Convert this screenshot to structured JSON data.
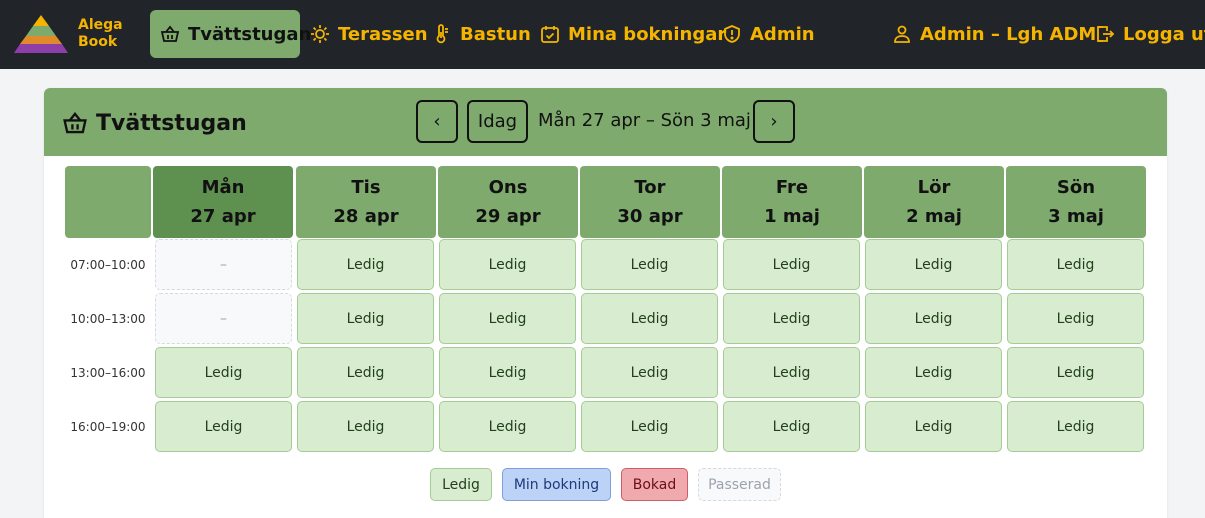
{
  "brand": {
    "line1": "Alega",
    "line2": "Book"
  },
  "nav": {
    "laundry": "Tvättstugan",
    "terrace": "Terassen",
    "sauna": "Bastun",
    "my_bookings": "Mina bokningar",
    "admin": "Admin",
    "user": "Admin – Lgh ADM",
    "logout": "Logga ut"
  },
  "card": {
    "title": "Tvättstugan",
    "today_label": "Idag",
    "prev_glyph": "‹",
    "next_glyph": "›",
    "week_range": "Mån 27 apr – Sön 3 maj"
  },
  "days": [
    {
      "name": "Mån",
      "date": "27 apr"
    },
    {
      "name": "Tis",
      "date": "28 apr"
    },
    {
      "name": "Ons",
      "date": "29 apr"
    },
    {
      "name": "Tor",
      "date": "30 apr"
    },
    {
      "name": "Fre",
      "date": "1 maj"
    },
    {
      "name": "Lör",
      "date": "2 maj"
    },
    {
      "name": "Sön",
      "date": "3 maj"
    }
  ],
  "times": [
    "07:00–10:00",
    "10:00–13:00",
    "13:00–16:00",
    "16:00–19:00"
  ],
  "slots": [
    [
      "–",
      "Ledig",
      "Ledig",
      "Ledig",
      "Ledig",
      "Ledig",
      "Ledig"
    ],
    [
      "–",
      "Ledig",
      "Ledig",
      "Ledig",
      "Ledig",
      "Ledig",
      "Ledig"
    ],
    [
      "Ledig",
      "Ledig",
      "Ledig",
      "Ledig",
      "Ledig",
      "Ledig",
      "Ledig"
    ],
    [
      "Ledig",
      "Ledig",
      "Ledig",
      "Ledig",
      "Ledig",
      "Ledig",
      "Ledig"
    ]
  ],
  "legend": {
    "free": "Ledig",
    "mine": "Min bokning",
    "booked": "Bokad",
    "passed": "Passerad"
  },
  "colors": {
    "navbar": "#212529",
    "accent": "#f4b400",
    "header_green": "#7faa6e",
    "today_green": "#5e9050",
    "free": "#d8ecd0",
    "mine": "#bcd3f7",
    "booked": "#f0a9ad"
  },
  "icons": {
    "laundry": "basket-icon",
    "terrace": "sun-icon",
    "sauna": "thermometer-icon",
    "my_bookings": "calendar-check-icon",
    "admin": "shield-icon",
    "user": "person-icon",
    "logout": "logout-icon"
  }
}
